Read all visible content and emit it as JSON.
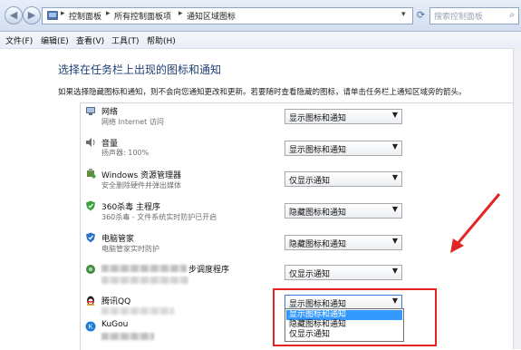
{
  "address_bar": {
    "breadcrumbs": [
      "控制面板",
      "所有控制面板项",
      "通知区域图标"
    ],
    "search_placeholder": "搜索控制面板"
  },
  "menubar": {
    "items": [
      "文件(F)",
      "编辑(E)",
      "查看(V)",
      "工具(T)",
      "帮助(H)"
    ]
  },
  "main": {
    "title": "选择在任务栏上出现的图标和通知",
    "description": "如果选择隐藏图标和通知，则不会向您通知更改和更新。若要随时查看隐藏的图标，请单击任务栏上通知区域旁的箭头。"
  },
  "rows": [
    {
      "name": "网络",
      "desc": "网络 Internet 访问",
      "behavior": "显示图标和通知",
      "icon": "network-icon"
    },
    {
      "name": "音量",
      "desc": "扬声器: 100%",
      "behavior": "显示图标和通知",
      "icon": "speaker-icon"
    },
    {
      "name": "Windows 资源管理器",
      "desc": "安全删除硬件并弹出媒体",
      "behavior": "仅显示通知",
      "icon": "usb-device-icon"
    },
    {
      "name": "360杀毒 主程序",
      "desc": "360杀毒 - 文件系统实时防护已开启",
      "behavior": "隐藏图标和通知",
      "icon": "shield-360-icon"
    },
    {
      "name": "电脑管家",
      "desc": "电脑管家实时防护",
      "behavior": "隐藏图标和通知",
      "icon": "tencent-guard-icon"
    },
    {
      "name": "步调度程序",
      "desc": "",
      "behavior": "仅显示通知",
      "icon": "sync-scheduler-icon"
    },
    {
      "name": "腾讯QQ",
      "desc": "",
      "behavior": "显示图标和通知",
      "icon": "qq-penguin-icon"
    },
    {
      "name": "KuGou",
      "desc": "",
      "behavior": "",
      "icon": "kugou-icon"
    }
  ],
  "dropdown_options": [
    "显示图标和通知",
    "隐藏图标和通知",
    "仅显示通知"
  ],
  "highlighted_option": "显示图标和通知",
  "colors": {
    "annotation": "#e32424",
    "selection": "#3399ff",
    "title": "#1e3f73"
  }
}
